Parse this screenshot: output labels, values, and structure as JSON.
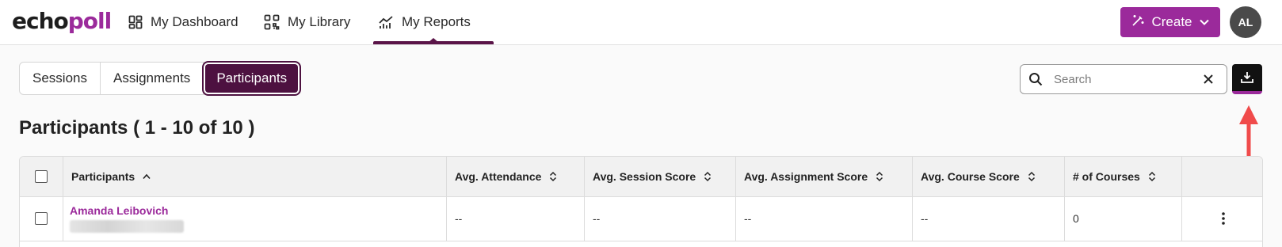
{
  "logo": {
    "part1": "echo",
    "part2": "poll"
  },
  "nav": {
    "items": [
      {
        "label": "My Dashboard",
        "icon": "dashboard-icon"
      },
      {
        "label": "My Library",
        "icon": "library-icon"
      },
      {
        "label": "My Reports",
        "icon": "reports-icon",
        "active": true
      }
    ]
  },
  "header": {
    "create_label": "Create",
    "avatar_initials": "AL"
  },
  "tabs": [
    {
      "label": "Sessions"
    },
    {
      "label": "Assignments"
    },
    {
      "label": "Participants",
      "active": true
    }
  ],
  "search": {
    "placeholder": "Search",
    "value": ""
  },
  "page": {
    "title": "Participants",
    "range": "( 1 - 10 of 10 )"
  },
  "table": {
    "columns": [
      "Participants",
      "Avg. Attendance",
      "Avg. Session Score",
      "Avg. Assignment Score",
      "Avg. Course Score",
      "# of Courses"
    ],
    "rows": [
      {
        "name": "Amanda Leibovich",
        "avg_attendance": "--",
        "avg_session_score": "--",
        "avg_assignment_score": "--",
        "avg_course_score": "--",
        "courses": "0"
      }
    ]
  },
  "colors": {
    "brand": "#9b2a9b",
    "brand_dark": "#4d1140",
    "annotation_arrow": "#f04b4b"
  },
  "icons": {
    "search": "search-icon",
    "clear": "close-icon",
    "export": "download-icon",
    "sort": "sort-icon",
    "row_menu": "more-vertical-icon"
  }
}
